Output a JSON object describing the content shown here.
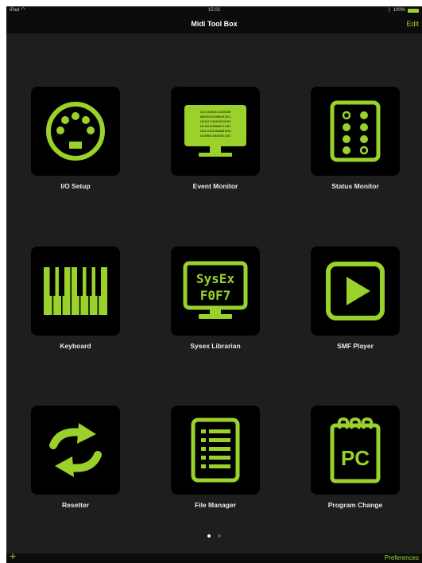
{
  "status_bar": {
    "device": "iPad",
    "time": "15:02",
    "battery": "100%"
  },
  "nav": {
    "title": "Midi Tool Box",
    "edit_label": "Edit"
  },
  "tiles": [
    {
      "label": "I/O Setup",
      "icon": "midi-din-icon"
    },
    {
      "label": "Event Monitor",
      "icon": "binary-monitor-icon"
    },
    {
      "label": "Status Monitor",
      "icon": "led-panel-icon"
    },
    {
      "label": "Keyboard",
      "icon": "piano-keys-icon"
    },
    {
      "label": "Sysex Librarian",
      "icon": "sysex-monitor-icon"
    },
    {
      "label": "SMF Player",
      "icon": "play-icon"
    },
    {
      "label": "Resetter",
      "icon": "refresh-arrows-icon"
    },
    {
      "label": "File Manager",
      "icon": "document-list-icon"
    },
    {
      "label": "Program Change",
      "icon": "notepad-pc-icon"
    }
  ],
  "sysex_icon_text": {
    "line1": "SysEx",
    "line2": "F0F7"
  },
  "pc_icon_text": "PC",
  "binary_text": [
    "1011101010111010100",
    "0001010101000101011",
    "1010111101010110101",
    "0111010100000111101",
    "0101110101000001010",
    "1010001110101011101"
  ],
  "page_indicator": {
    "pages": 2,
    "current": 1
  },
  "bottom_bar": {
    "add_label": "+",
    "preferences_label": "Preferences"
  },
  "colors": {
    "accent": "#9ad12b",
    "background": "#1e1e1e",
    "tile": "#000000"
  }
}
